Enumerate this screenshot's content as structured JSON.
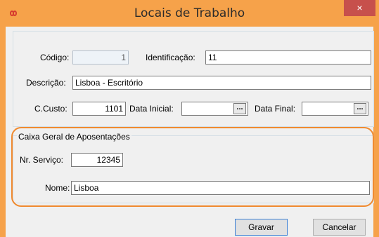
{
  "window": {
    "title": "Locais de Trabalho",
    "app_icon": "infinity-icon",
    "close_glyph": "×",
    "accent_color": "#f6a24a"
  },
  "form": {
    "codigo": {
      "label": "Código:",
      "value": "1"
    },
    "identificacao": {
      "label": "Identificação:",
      "value": "11"
    },
    "descricao": {
      "label": "Descrição:",
      "value": "Lisboa - Escritório"
    },
    "ccusto": {
      "label": "C.Custo:",
      "value": "1101"
    },
    "data_inicial": {
      "label": "Data Inicial:",
      "value": "",
      "button": "..."
    },
    "data_final": {
      "label": "Data Final:",
      "value": "",
      "button": "..."
    }
  },
  "cga": {
    "legend": "Caixa Geral de Aposentações",
    "nr_servico": {
      "label": "Nr. Serviço:",
      "value": "12345"
    },
    "nome": {
      "label": "Nome:",
      "value": "Lisboa"
    },
    "highlight_color": "#f08a2f"
  },
  "buttons": {
    "gravar": "Gravar",
    "cancelar": "Cancelar"
  }
}
